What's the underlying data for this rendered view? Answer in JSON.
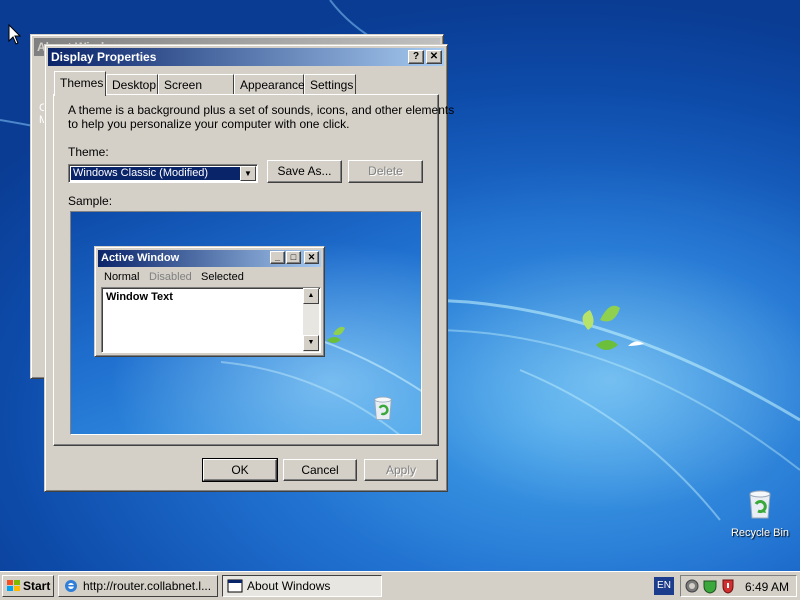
{
  "desktop": {
    "recycle_bin_label": "Recycle Bin"
  },
  "about_window": {
    "title": "About Windows",
    "side_text": [
      "C",
      "M"
    ]
  },
  "dialog": {
    "title": "Display Properties",
    "help_btn": "?",
    "close_btn": "✕",
    "tabs": [
      {
        "label": "Themes",
        "selected": true
      },
      {
        "label": "Desktop",
        "selected": false
      },
      {
        "label": "Screen Saver",
        "selected": false
      },
      {
        "label": "Appearance",
        "selected": false
      },
      {
        "label": "Settings",
        "selected": false
      }
    ],
    "description_line1": "A theme is a background plus a set of sounds, icons, and other elements",
    "description_line2": "to help you personalize your computer with one click.",
    "theme_label": "Theme:",
    "theme_value": "Windows Classic (Modified)",
    "save_as_label": "Save As...",
    "delete_label": "Delete",
    "sample_label": "Sample:",
    "sample": {
      "window_title": "Active Window",
      "menu": [
        {
          "label": "Normal",
          "state": "normal"
        },
        {
          "label": "Disabled",
          "state": "disabled"
        },
        {
          "label": "Selected",
          "state": "selected"
        }
      ],
      "window_text": "Window Text"
    },
    "ok_label": "OK",
    "cancel_label": "Cancel",
    "apply_label": "Apply"
  },
  "taskbar": {
    "start_label": "Start",
    "tasks": [
      {
        "label": "http://router.collabnet.l...",
        "icon": "ie-icon",
        "pressed": false
      },
      {
        "label": "About Windows",
        "icon": "window-icon",
        "pressed": true
      }
    ],
    "language": "EN",
    "clock": "6:49 AM"
  },
  "colors": {
    "title_active_start": "#0a246a",
    "title_active_end": "#a6caf0",
    "face": "#d4d0c8"
  }
}
